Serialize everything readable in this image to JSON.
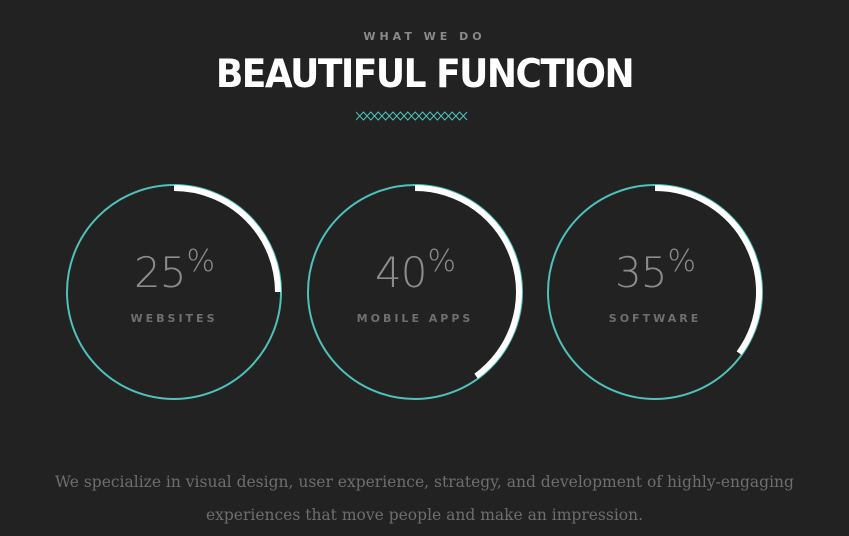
{
  "section": {
    "eyebrow": "WHAT WE DO",
    "title": "BEAUTIFUL FUNCTION",
    "divider_icon": "zigzag-divider"
  },
  "stats": [
    {
      "value": "25",
      "unit": "%",
      "label": "WEBSITES",
      "fraction": 0.25
    },
    {
      "value": "40",
      "unit": "%",
      "label": "MOBILE APPS",
      "fraction": 0.4
    },
    {
      "value": "35",
      "unit": "%",
      "label": "SOFTWARE",
      "fraction": 0.35
    }
  ],
  "description": "We specialize in visual design, user experience, strategy, and development of highly-engaging experiences that move people and make an impression.",
  "colors": {
    "background": "#222222",
    "ring": "#4fc1bb",
    "progress": "#ffffff",
    "title": "#ffffff",
    "muted": "#8a8a8a"
  }
}
